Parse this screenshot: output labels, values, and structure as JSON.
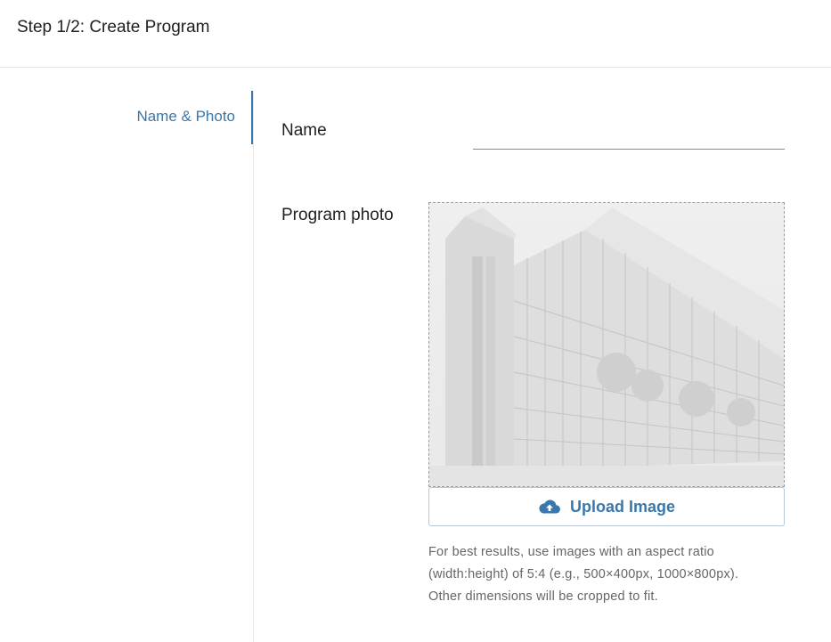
{
  "header": {
    "title": "Step 1/2: Create Program"
  },
  "sidebar": {
    "items": [
      {
        "label": "Name & Photo",
        "active": true
      }
    ]
  },
  "form": {
    "name": {
      "label": "Name",
      "value": "",
      "placeholder": ""
    },
    "photo": {
      "label": "Program photo",
      "upload_label": "Upload Image",
      "upload_icon": "cloud-upload-icon",
      "hint_lines": [
        "For best results, use images with an aspect ratio",
        "(width:height) of 5:4 (e.g., 500×400px, 1000×800px).",
        "Other dimensions will be cropped to fit."
      ]
    }
  },
  "colors": {
    "accent": "#3a77ab",
    "divider": "#e3e3e3"
  }
}
